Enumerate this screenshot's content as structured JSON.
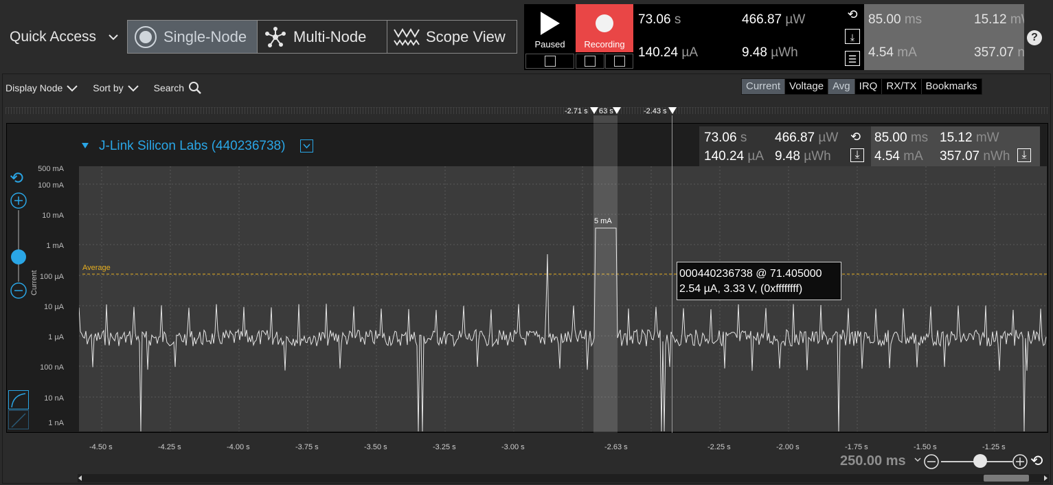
{
  "quick_access": {
    "label": "Quick Access"
  },
  "modes": [
    {
      "label": "Single-Node",
      "icon": "single-node-icon",
      "active": true
    },
    {
      "label": "Multi-Node",
      "icon": "multi-node-icon",
      "active": false
    },
    {
      "label": "Scope View",
      "icon": "scope-view-icon",
      "active": false
    }
  ],
  "controls": {
    "paused_label": "Paused",
    "recording_label": "Recording"
  },
  "header_stats": {
    "time": "73.06",
    "time_u": "s",
    "current": "140.24",
    "current_u": "µA",
    "power": "466.87",
    "power_u": "µW",
    "energy": "9.48",
    "energy_u": "µWh",
    "sel_time": "85.00",
    "sel_time_u": "ms",
    "sel_current": "4.54",
    "sel_current_u": "mA",
    "sel_power": "15.12",
    "sel_power_u": "mW",
    "sel_energy": "357.07",
    "sel_energy_u": "n"
  },
  "toolbar": {
    "display_node": "Display Node",
    "sort_by": "Sort by",
    "search": "Search"
  },
  "channel_tabs": [
    {
      "label": "Current",
      "on": true
    },
    {
      "label": "Voltage",
      "on": false
    },
    {
      "label": "Avg",
      "on": true
    },
    {
      "label": "IRQ",
      "on": false
    },
    {
      "label": "RX/TX",
      "on": false
    },
    {
      "label": "Bookmarks",
      "on": false
    }
  ],
  "markers": {
    "m1": "-2.71 s",
    "m2": "63 s",
    "m3": "-2.43 s"
  },
  "node": {
    "title": "J-Link Silicon Labs (440236738)",
    "time": "73.06",
    "time_u": "s",
    "current": "140.24",
    "current_u": "µA",
    "power": "466.87",
    "power_u": "µW",
    "energy": "9.48",
    "energy_u": "µWh",
    "sel_time": "85.00",
    "sel_time_u": "ms",
    "sel_current": "4.54",
    "sel_current_u": "mA",
    "sel_power": "15.12",
    "sel_power_u": "mW",
    "sel_energy": "357.07",
    "sel_energy_u": "nWh"
  },
  "y_axis": {
    "label": "Current",
    "ticks": [
      "500 mA",
      "100 mA",
      "10 mA",
      "1 mA",
      "100 µA",
      "10 µA",
      "1 µA",
      "100 nA",
      "10 nA",
      "1 nA"
    ]
  },
  "x_axis": {
    "ticks": [
      "-4.50 s",
      "-4.25 s",
      "-4.00 s",
      "-3.75 s",
      "-3.50 s",
      "-3.25 s",
      "-3.00 s",
      "-2.63 s",
      "-2.25 s",
      "-2.00 s",
      "-1.75 s",
      "-1.50 s",
      "-1.25 s"
    ]
  },
  "average_label": "Average",
  "selection_label": "5 mA",
  "tooltip": {
    "line1": "000440236738 @ 71.405000",
    "line2": "2.54 µA, 3.33 V, (0xffffffff)"
  },
  "zoom": {
    "label": "250.00 ms"
  },
  "colors": {
    "accent": "#2aa6e6",
    "record": "#e94646",
    "average": "#e8b020"
  }
}
